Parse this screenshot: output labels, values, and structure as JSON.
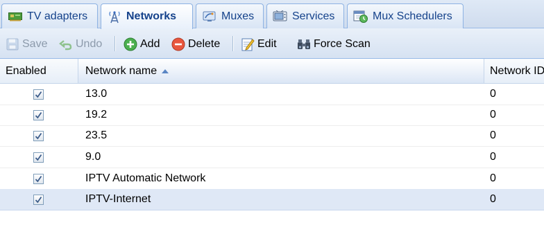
{
  "tabs": [
    {
      "label": "TV adapters",
      "icon": "tv-card-icon",
      "active": false
    },
    {
      "label": "Networks",
      "icon": "antenna-icon",
      "active": true
    },
    {
      "label": "Muxes",
      "icon": "satellite-dish-icon",
      "active": false
    },
    {
      "label": "Services",
      "icon": "television-icon",
      "active": false
    },
    {
      "label": "Mux Schedulers",
      "icon": "calendar-clock-icon",
      "active": false
    }
  ],
  "toolbar": {
    "save": "Save",
    "undo": "Undo",
    "add": "Add",
    "delete": "Delete",
    "edit": "Edit",
    "force_scan": "Force Scan"
  },
  "grid": {
    "columns": [
      "Enabled",
      "Network name",
      "Network ID"
    ],
    "sorted_column": "Network name",
    "sort_direction": "ascending",
    "rows": [
      {
        "enabled": true,
        "name": "13.0",
        "network_id": "0",
        "selected": false
      },
      {
        "enabled": true,
        "name": "19.2",
        "network_id": "0",
        "selected": false
      },
      {
        "enabled": true,
        "name": "23.5",
        "network_id": "0",
        "selected": false
      },
      {
        "enabled": true,
        "name": "9.0",
        "network_id": "0",
        "selected": false
      },
      {
        "enabled": true,
        "name": "IPTV Automatic Network",
        "network_id": "0",
        "selected": false
      },
      {
        "enabled": true,
        "name": "IPTV-Internet",
        "network_id": "0",
        "selected": true
      }
    ]
  },
  "colors": {
    "tab_text": "#15428b",
    "selected_row": "#dfe8f6",
    "header_border": "#99bbe8"
  }
}
